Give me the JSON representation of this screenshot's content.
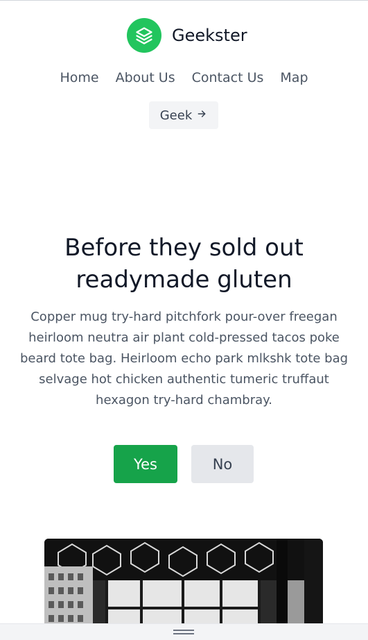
{
  "brand": {
    "name": "Geekster",
    "logo_icon": "layers-icon",
    "accent": "#22c55e"
  },
  "nav": {
    "items": [
      "Home",
      "About Us",
      "Contact Us",
      "Map"
    ]
  },
  "header_button": {
    "label": "Geek",
    "icon": "arrow-right-icon"
  },
  "hero": {
    "title": "Before they sold out readymade gluten",
    "text": "Copper mug try-hard pitchfork pour-over freegan heirloom neutra air plant cold-pressed tacos poke beard tote bag. Heirloom echo park mlkshk tote bag selvage hot chicken authentic tumeric truffaut hexagon try-hard chambray.",
    "yes_label": "Yes",
    "no_label": "No",
    "yes_color": "#16a34a",
    "image_icon": "office-interior-photo"
  }
}
